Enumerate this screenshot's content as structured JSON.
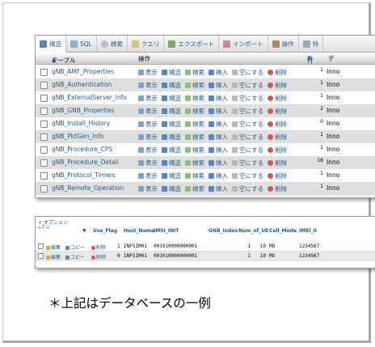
{
  "tabs": [
    "構造",
    "SQL",
    "検索",
    "クエリ",
    "エクスポート",
    "インポート",
    "操作",
    "特"
  ],
  "table_header": {
    "table_col": "テーブル",
    "sort_arrow": "▲",
    "action_col": "操作",
    "rows_col": "行",
    "extra_col": "デ"
  },
  "row_actions": [
    "表示",
    "構造",
    "検索",
    "挿入",
    "空にする",
    "削除"
  ],
  "tables": [
    {
      "name": "gNB_AMF_Properties",
      "rows": "1",
      "engine": "Inno"
    },
    {
      "name": "gNB_Authentication",
      "rows": "1",
      "engine": "Inno"
    },
    {
      "name": "gNB_ExternalServer_Info",
      "rows": "1",
      "engine": "Inno"
    },
    {
      "name": "gNB_GNB_Properties",
      "rows": "2",
      "engine": "Inno"
    },
    {
      "name": "gNB_Install_History",
      "rows": "0",
      "engine": "Inno"
    },
    {
      "name": "gNB_PktGen_Info",
      "rows": "1",
      "engine": "Inno"
    },
    {
      "name": "gNB_Procedure_CPS",
      "rows": "1",
      "engine": "Inno"
    },
    {
      "name": "gNB_Procedure_Detail",
      "rows": "18",
      "engine": "Inno"
    },
    {
      "name": "gNB_Protocol_Timers",
      "rows": "1",
      "engine": "Inno"
    },
    {
      "name": "gNB_Remote_Operation",
      "rows": "1",
      "engine": "Inno"
    }
  ],
  "browse": {
    "options_link": "+ オプション",
    "nav_arrows": "←T→",
    "columns": [
      "Use_Flag",
      "Host_Name",
      "IMSI_INIT",
      "GNB_Index",
      "Num_of_UE",
      "Call_Mode",
      "IMEI_II"
    ],
    "row_actions": [
      "編集",
      "コピー",
      "削除"
    ],
    "rows": [
      {
        "use_flag": "1",
        "host": "INFSIM01",
        "imsi": "001010000000001",
        "gnb_index": "1",
        "num_ue": "10",
        "call_mode": "MO",
        "imei": "1234567"
      },
      {
        "use_flag": "0",
        "host": "INFSIM01",
        "imsi": "001010000000001",
        "gnb_index": "1",
        "num_ue": "10",
        "call_mode": "MO",
        "imei": "1234567"
      }
    ]
  },
  "caption": "＊上記はデータベースの一例"
}
